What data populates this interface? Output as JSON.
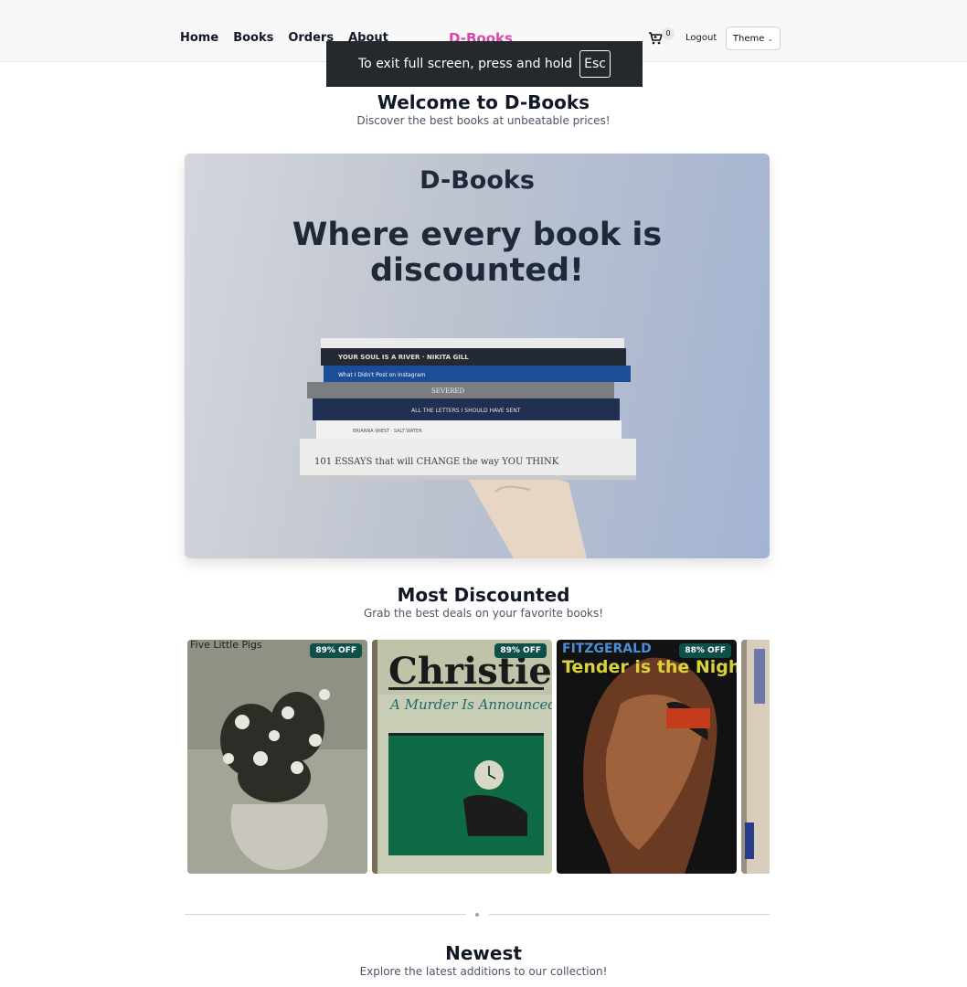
{
  "nav": {
    "links": [
      "Home",
      "Books",
      "Orders",
      "About"
    ],
    "brand": "D-Books",
    "cart_count": "0",
    "logout": "Logout",
    "theme": "Theme",
    "cart_icon": "cart-icon",
    "theme_icon": "chevron-down-icon"
  },
  "toast": {
    "message": "To exit full screen, press and hold",
    "key": "Esc"
  },
  "welcome": {
    "title": "Welcome to D-Books",
    "subtitle": "Discover the best books at unbeatable prices!"
  },
  "hero": {
    "brand": "D-Books",
    "tagline": "Where every book is discounted!",
    "books": [
      "YOUR SOUL IS A RIVER · NIKITA GILL",
      "What I Didn't Post on Instagram",
      "SEVERED",
      "ALL THE LETTERS I SHOULD HAVE SENT",
      "BRIANNA WIEST · SALT WATER",
      "101 ESSAYS that will CHANGE the way YOU THINK"
    ]
  },
  "most_discounted": {
    "title": "Most Discounted",
    "subtitle": "Grab the best deals on your favorite books!",
    "cards": [
      {
        "cover_text": "Five Little Pigs",
        "badge": "89% OFF"
      },
      {
        "cover_text": "A Murder Is Announced",
        "badge": "89% OFF"
      },
      {
        "cover_text": "Tender is the Night",
        "badge": "88% OFF"
      },
      {
        "cover_text": "",
        "badge": ""
      }
    ]
  },
  "newest": {
    "title": "Newest",
    "subtitle": "Explore the latest additions to our collection!"
  },
  "colors": {
    "brand": "#d946a8",
    "badge": "#0f4f4a",
    "nav_bg": "#f8f8f8",
    "toast_bg": "#25282c"
  }
}
